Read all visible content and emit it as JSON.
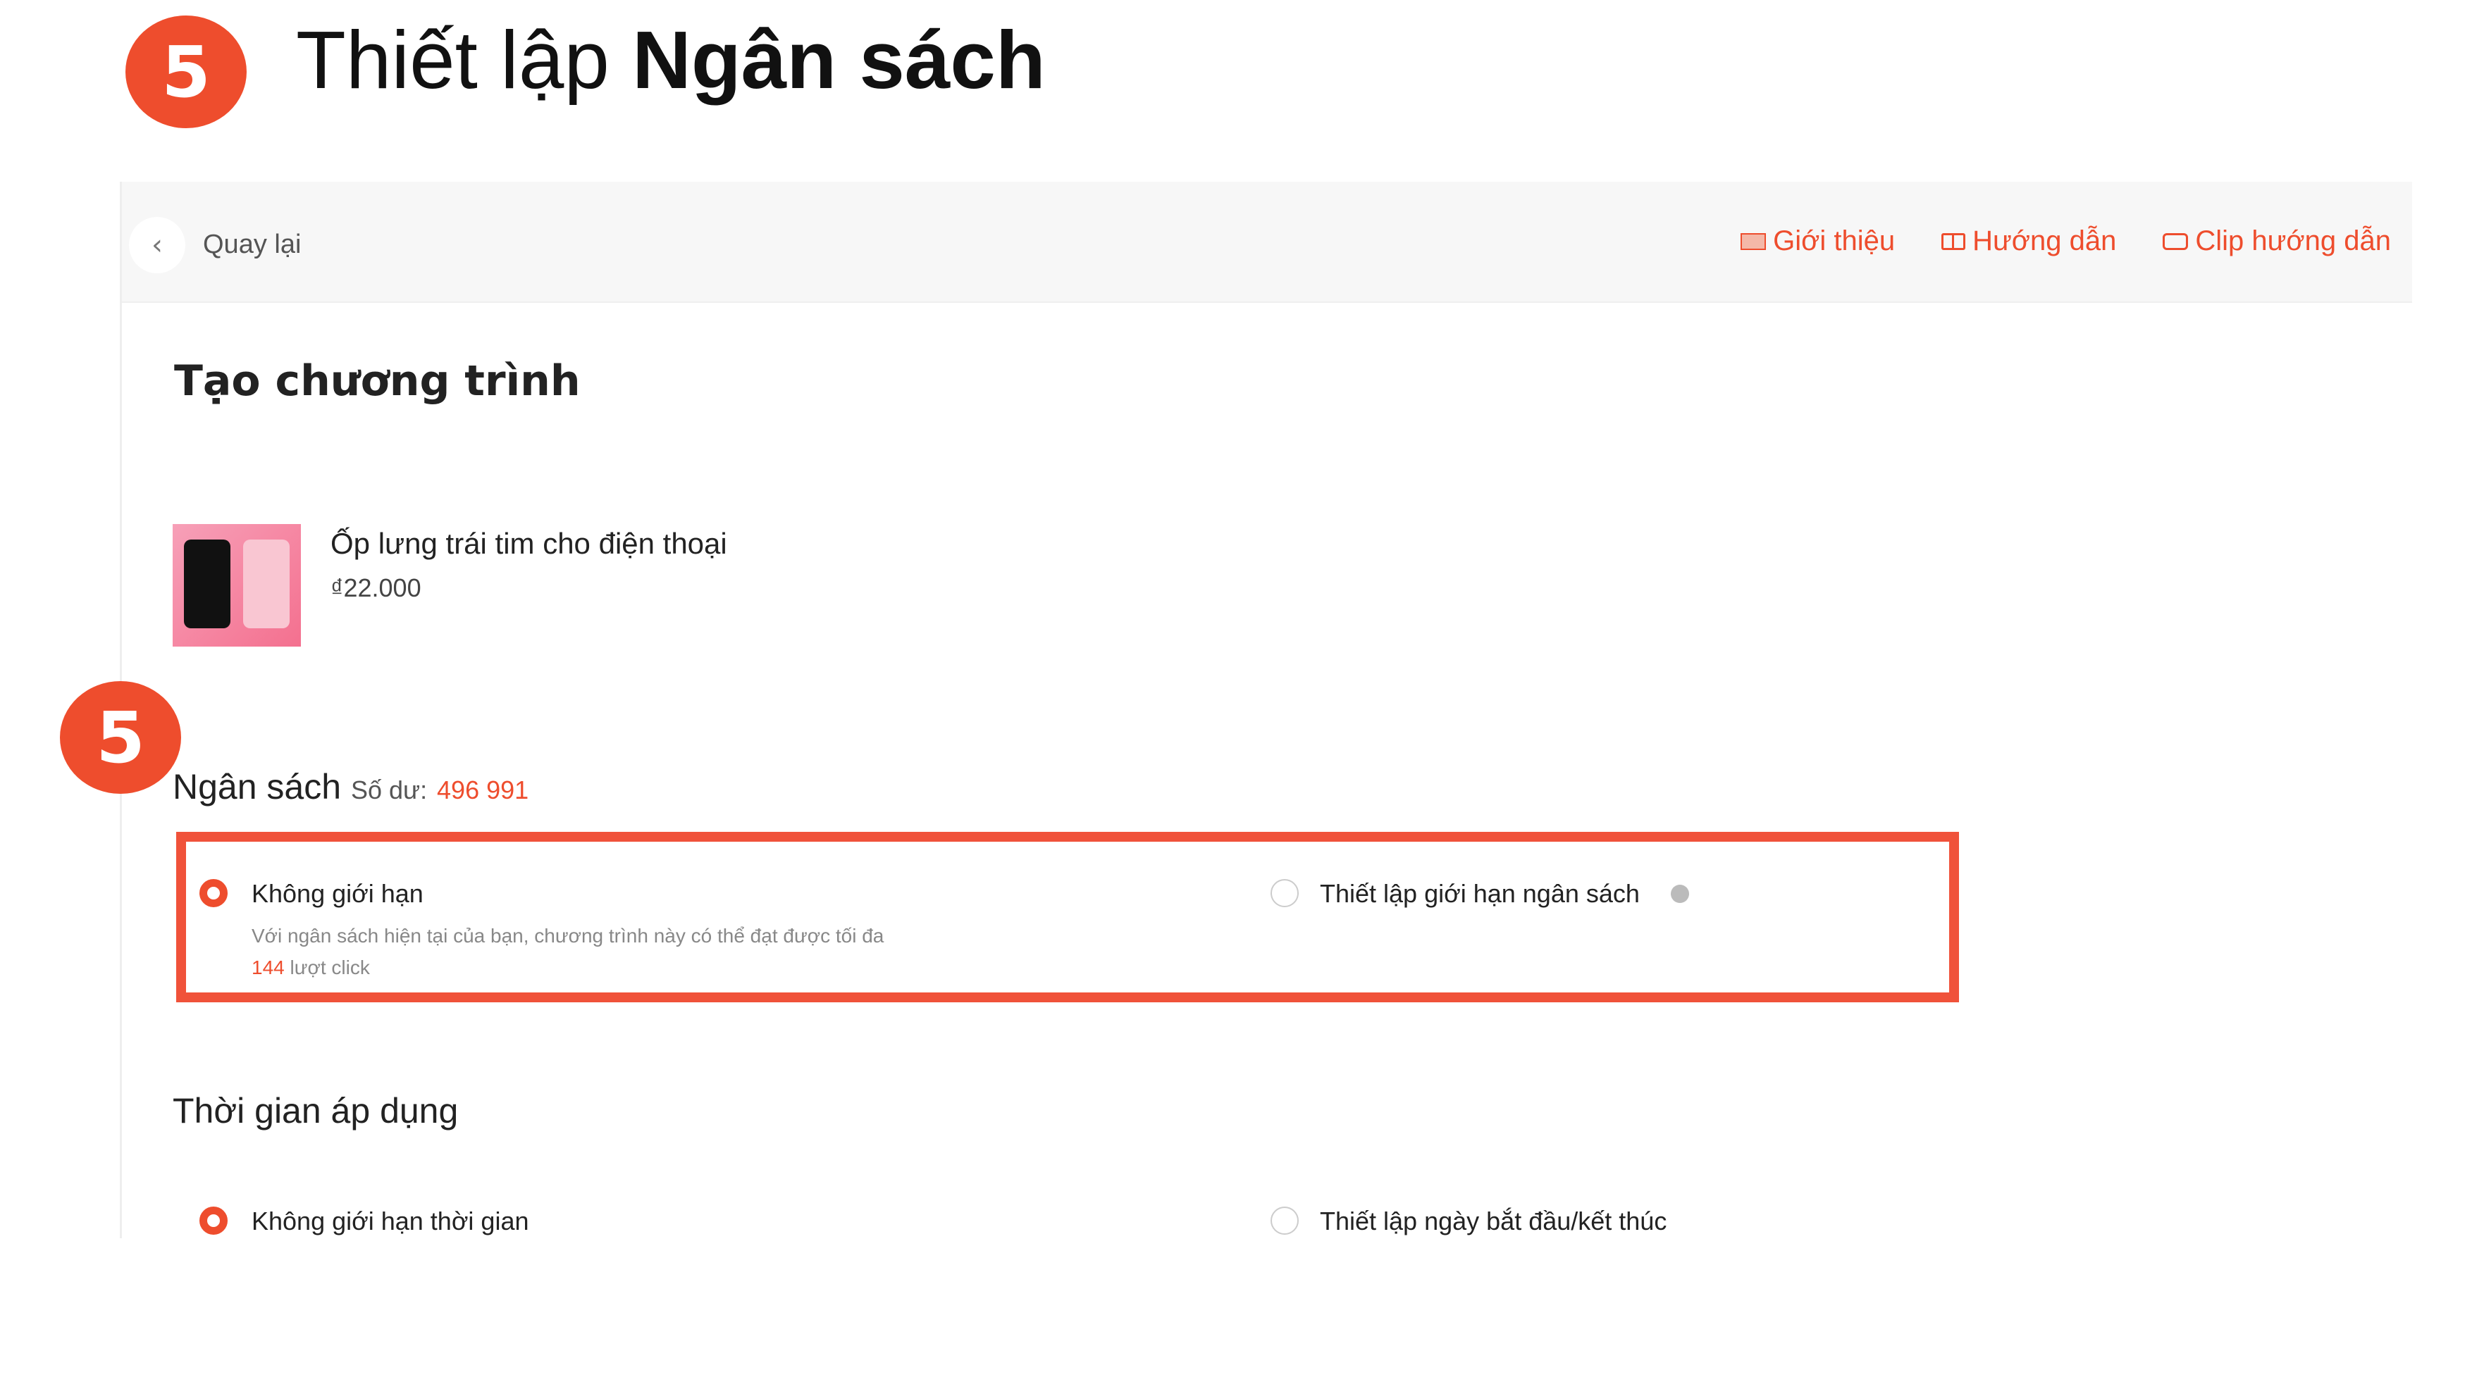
{
  "tutorial": {
    "step_number": "5",
    "title_prefix": "Thiết lập",
    "title_bold": "Ngân sách"
  },
  "topbar": {
    "back_label": "Quay lại",
    "links": [
      {
        "label": "Giới thiệu",
        "icon": "intro-icon"
      },
      {
        "label": "Hướng dẫn",
        "icon": "book-icon"
      },
      {
        "label": "Clip hướng dẫn",
        "icon": "video-icon"
      }
    ]
  },
  "main": {
    "title": "Tạo chương trình",
    "product": {
      "name": "Ốp lưng trái tim cho điện thoại",
      "price": "₫22.000"
    },
    "budget": {
      "title": "Ngân sách",
      "balance_label": "Số dư:",
      "balance_value": "496 991",
      "options": [
        {
          "label": "Không giới hạn",
          "selected": true
        },
        {
          "label": "Thiết lập giới hạn ngân sách",
          "selected": false
        }
      ],
      "desc_text": "Với ngân sách hiện tại của bạn, chương trình này có thể đạt được tối đa",
      "desc_count": "144",
      "desc_suffix": "lượt click"
    },
    "time": {
      "title": "Thời gian áp dụng",
      "options": [
        {
          "label": "Không giới hạn thời gian",
          "selected": true
        },
        {
          "label": "Thiết lập ngày bắt đầu/kết thúc",
          "selected": false
        }
      ]
    }
  },
  "colors": {
    "accent": "#ee4d2d",
    "highlight_border": "#f0523a"
  }
}
